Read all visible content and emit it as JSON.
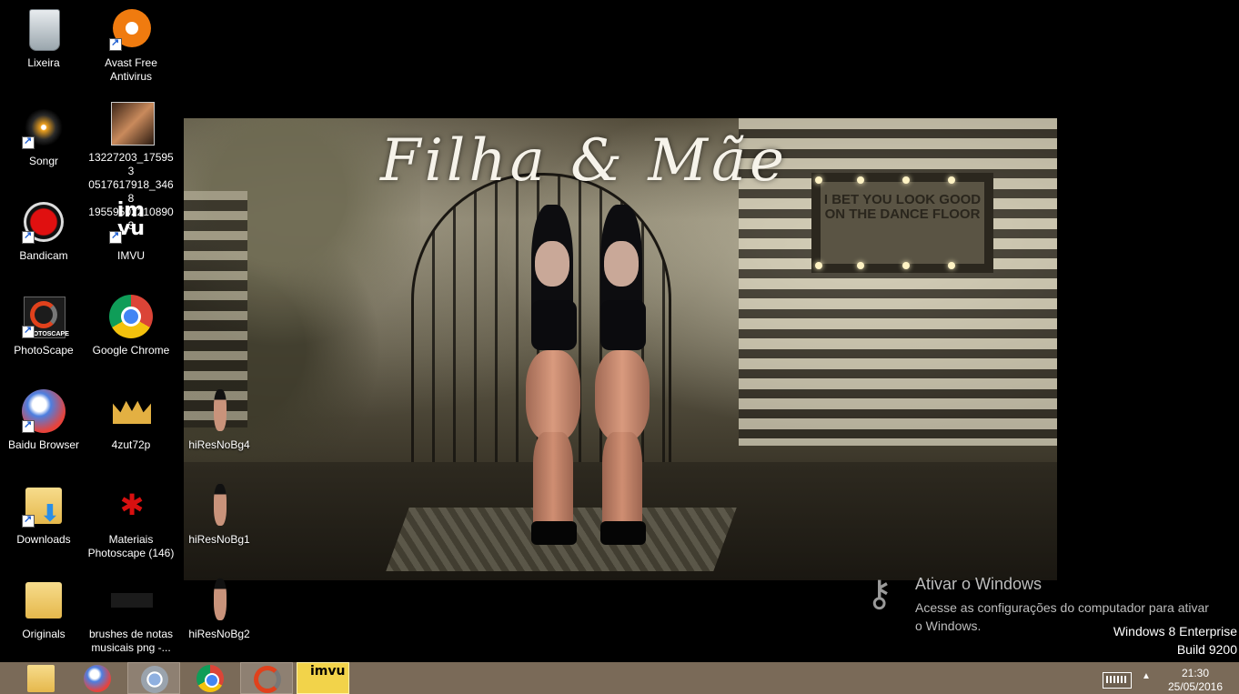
{
  "desktop": {
    "wallpaper": {
      "title": "Filha & Mãe",
      "sign_text": "I BET YOU LOOK GOOD ON THE DANCE FLOOR"
    },
    "icons": [
      {
        "label": "Lixeira",
        "icon": "recycle-bin-icon"
      },
      {
        "label": "Avast Free Antivirus",
        "icon": "avast-icon"
      },
      {
        "label": "Songr",
        "icon": "songr-icon"
      },
      {
        "label": "13227203_175953 0517617918_3468 195595022108903",
        "icon": "image-file-icon"
      },
      {
        "label": "Bandicam",
        "icon": "bandicam-icon"
      },
      {
        "label": "IMVU",
        "icon": "imvu-icon"
      },
      {
        "label": "PhotoScape",
        "icon": "photoscape-icon"
      },
      {
        "label": "Google Chrome",
        "icon": "chrome-icon"
      },
      {
        "label": "Baidu Browser",
        "icon": "baidu-browser-icon"
      },
      {
        "label": "4zut72p",
        "icon": "crown-image-icon"
      },
      {
        "label": "hiResNoBg4",
        "icon": "image-file-icon"
      },
      {
        "label": "Downloads",
        "icon": "downloads-folder-icon"
      },
      {
        "label": "Materiais Photoscape (146)",
        "icon": "leaf-image-icon"
      },
      {
        "label": "hiResNoBg1",
        "icon": "image-file-icon"
      },
      {
        "label": "Originals",
        "icon": "folder-icon"
      },
      {
        "label": "brushes de notas musicais png -...",
        "icon": "image-file-icon"
      },
      {
        "label": "hiResNoBg2",
        "icon": "image-file-icon"
      }
    ]
  },
  "activation": {
    "title": "Ativar o Windows",
    "message": "Acesse as configurações do computador para ativar o Windows."
  },
  "windows_version": {
    "edition": "Windows 8 Enterprise",
    "build": "Build 9200"
  },
  "taskbar": {
    "apps": [
      {
        "name": "file-explorer-icon"
      },
      {
        "name": "baidu-browser-icon"
      },
      {
        "name": "chrome-app-icon"
      },
      {
        "name": "google-chrome-icon"
      },
      {
        "name": "photoscape-icon"
      },
      {
        "name": "imvu-icon",
        "label": "imvu"
      }
    ],
    "clock": {
      "time": "21:30",
      "date": "25/05/2016"
    }
  }
}
